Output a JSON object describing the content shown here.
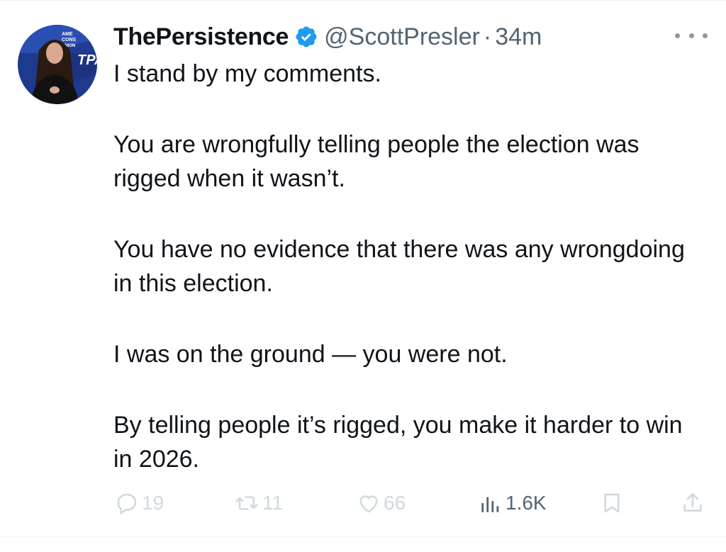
{
  "tweet": {
    "display_name": "ThePersistence",
    "handle": "@ScottPresler",
    "separator": "·",
    "time": "34m",
    "paragraphs": [
      "I stand by my comments.",
      "You are wrongfully telling people the election was rigged when it wasn’t.",
      "You have no evidence that there was any wrongdoing in this election.",
      "I was on the ground — you were not.",
      "By telling people it’s rigged, you make it harder to win in 2026."
    ],
    "avatar_logo_text": [
      "AME",
      "CONS",
      "UNION",
      "TPA"
    ]
  },
  "actions": {
    "replies": "19",
    "reposts": "11",
    "likes": "66",
    "views": "1.6K"
  },
  "icons": {
    "verified": "verified-badge-icon",
    "more": "more-options-icon",
    "reply": "reply-icon",
    "repost": "repost-icon",
    "like": "like-icon",
    "views": "views-icon",
    "bookmark": "bookmark-icon",
    "share": "share-icon"
  },
  "colors": {
    "verified_blue": "#1d9bf0",
    "text": "#0f1419",
    "secondary": "#536471",
    "faded_action": "#cfd9de"
  }
}
